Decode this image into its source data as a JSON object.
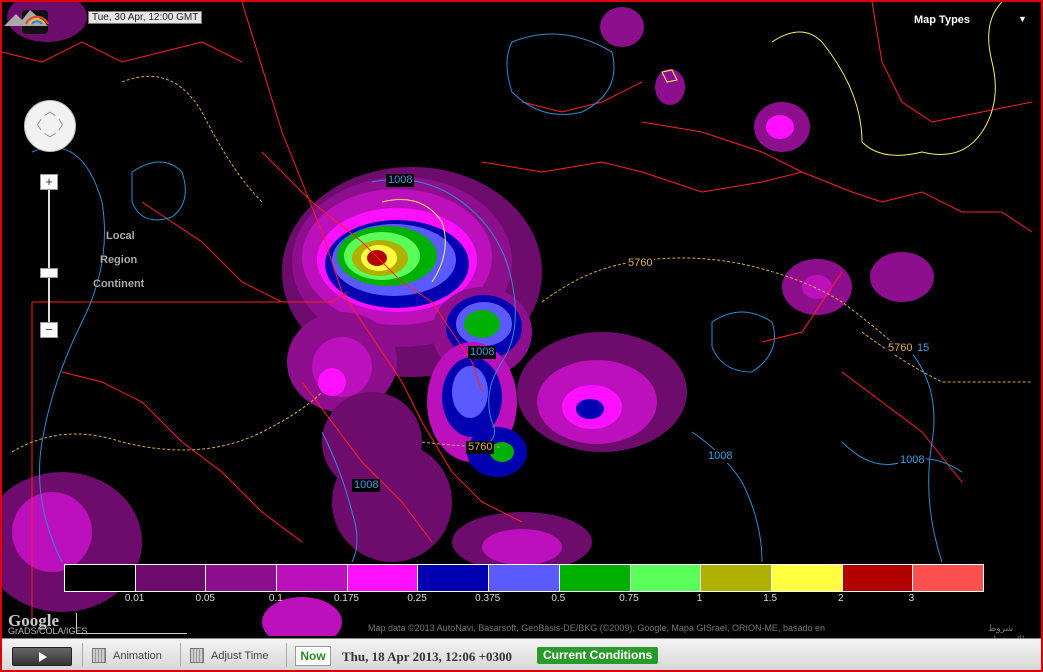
{
  "map": {
    "timestamp": "Tue, 30 Apr, 12:00 GMT",
    "map_types_label": "Map Types",
    "hl_icon": "HL",
    "scale_options": [
      "Local",
      "Region",
      "Continent"
    ],
    "zoom_in": "+",
    "zoom_out": "−",
    "contour_labels": {
      "pressure_1008_a": "1008",
      "pressure_1008_b": "1008",
      "pressure_1008_c": "1008",
      "pressure_1008_d": "1008",
      "pressure_1008_e": "1008",
      "height_5760_a": "5760",
      "height_5760_b": "5760",
      "height_5760_c": "5760",
      "suffix_15": "15"
    },
    "attribution": "Map data ©2013 AutoNavi, Basarsoft, GeoBasis-DE/BKG (©2009), Google, Mapa GISrael, ORION-ME, basado en",
    "terms": "شروط الاستخدام",
    "google_logo": "Google",
    "grads_credit": "GrADS/COLA/IGES"
  },
  "legend": {
    "colors": [
      "#000000",
      "#6e0c6e",
      "#8e0f8e",
      "#bb10bb",
      "#ff10ff",
      "#0000b0",
      "#5a5aff",
      "#00b000",
      "#5aff5a",
      "#b0b000",
      "#ffff40",
      "#b00000",
      "#ff5050"
    ],
    "labels": [
      "0.01",
      "0.05",
      "0.1",
      "0.175",
      "0.25",
      "0.375",
      "0.5",
      "0.75",
      "1",
      "1.5",
      "2",
      "3"
    ]
  },
  "toolbar": {
    "animation": "Animation",
    "adjust_time": "Adjust Time",
    "now": "Now",
    "datetime": "Thu, 18 Apr 2013, 12:06 +0300",
    "current_conditions": "Current Conditions"
  }
}
